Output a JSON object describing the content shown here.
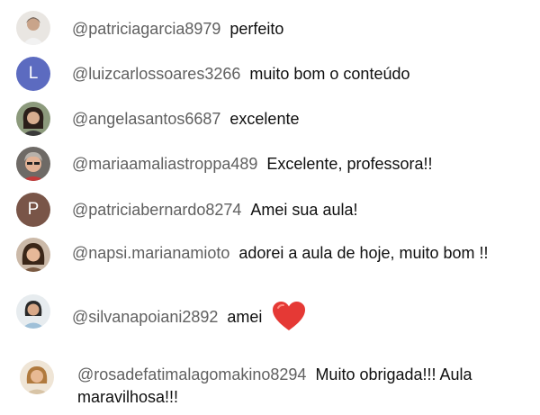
{
  "comments": [
    {
      "author": "@patriciagarcia8979",
      "text": "perfeito",
      "avatar_icon": "person-photo-icon"
    },
    {
      "author": "@luizcarlossoares3266",
      "text": "muito bom o conteúdo",
      "avatar_letter": "L",
      "avatar_color": "#5c6bc0"
    },
    {
      "author": "@angelasantos6687",
      "text": "excelente",
      "avatar_icon": "person-photo-icon"
    },
    {
      "author": "@mariaamaliastroppa489",
      "text": "Excelente, professora!!",
      "avatar_icon": "person-photo-icon"
    },
    {
      "author": "@patriciabernardo8274",
      "text": "Amei sua aula!",
      "avatar_letter": "P",
      "avatar_color": "#795548"
    },
    {
      "author": "@napsi.marianamioto",
      "text": "adorei a aula de hoje, muito bom !!",
      "avatar_icon": "person-photo-icon"
    },
    {
      "author": "@silvanapoiani2892",
      "text": "amei",
      "avatar_icon": "person-photo-icon",
      "emoji": "heart-icon",
      "emoji_color": "#e53935"
    },
    {
      "author": "@rosadefatimalagomakino8294",
      "text": "Muito obrigada!!! Aula maravilhosa!!!",
      "avatar_icon": "person-photo-icon"
    }
  ]
}
